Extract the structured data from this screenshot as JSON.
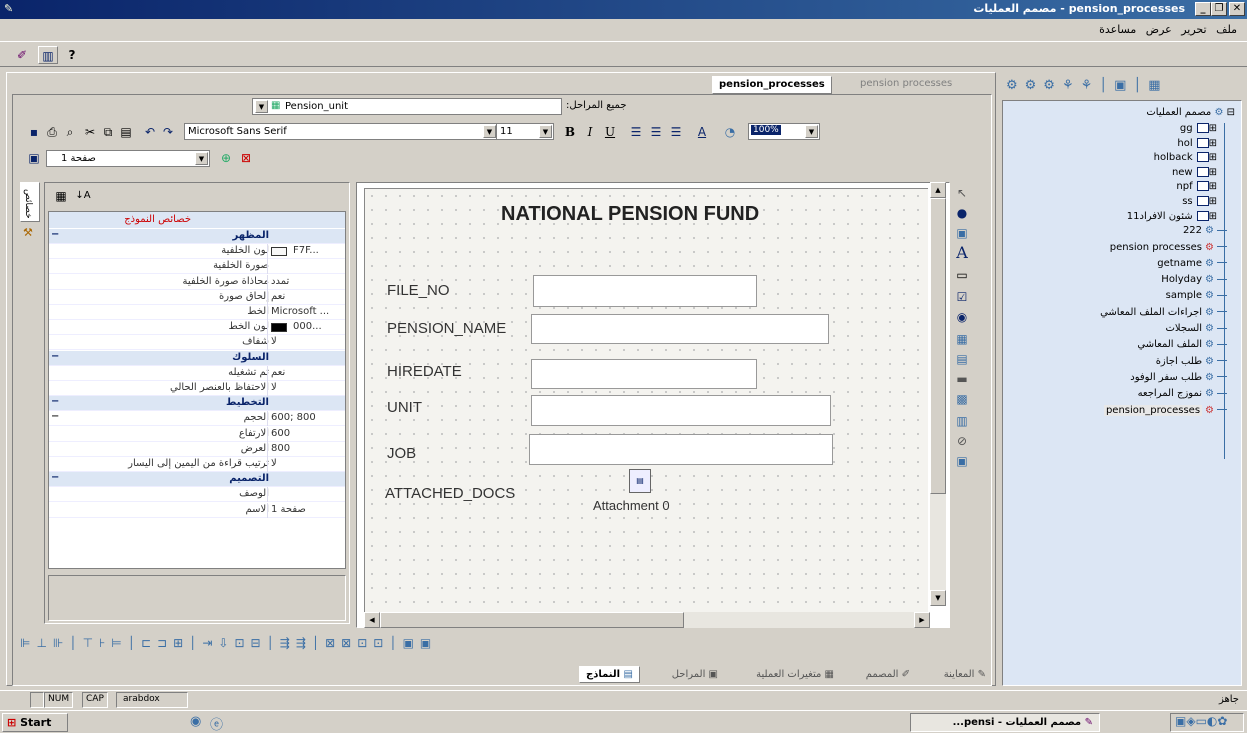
{
  "window": {
    "title": "pension_processes - مصمم العمليات"
  },
  "menu": [
    "ملف",
    "تحرير",
    "عرض",
    "مساعدة"
  ],
  "designer_tabs": {
    "active": "pension_processes",
    "inactive": "pension processes"
  },
  "stage_bar": {
    "label": "جميع المراحل:",
    "form_select": "Pension_unit"
  },
  "format_toolbar": {
    "font": "Microsoft Sans Serif",
    "size": "11",
    "zoom": "100%"
  },
  "page_select": "صفحة 1",
  "properties": {
    "side_tabs": [
      "خصائص",
      "أدوات"
    ],
    "header": "خصائص النموذج",
    "rows": [
      {
        "type": "cat",
        "label": "المظهر",
        "mark": "−"
      },
      {
        "type": "row",
        "label": "لون الخلفية",
        "value": "F7F..."
      },
      {
        "type": "row",
        "label": "صورة الخلفية",
        "value": ""
      },
      {
        "type": "row",
        "label": "محاذاة صورة الخلفية",
        "value": "تمدد"
      },
      {
        "type": "row",
        "label": "إلحاق صورة",
        "value": "نعم"
      },
      {
        "type": "row",
        "label": "الخط",
        "value": "Microsoft ..."
      },
      {
        "type": "row",
        "label": "لون الخط",
        "value": "000..."
      },
      {
        "type": "row",
        "label": "شفاف",
        "value": "لا"
      },
      {
        "type": "cat",
        "label": "السلوك",
        "mark": "−"
      },
      {
        "type": "row",
        "label": "تم تشغيله",
        "value": "نعم"
      },
      {
        "type": "row",
        "label": "الاحتفاظ بالعنصر الحالي",
        "value": "لا"
      },
      {
        "type": "cat",
        "label": "التخطيط",
        "mark": "−"
      },
      {
        "type": "row",
        "label": "الحجم",
        "value": "600; 800",
        "mark": "−"
      },
      {
        "type": "row",
        "label": "الارتفاع",
        "value": "600"
      },
      {
        "type": "row",
        "label": "العرض",
        "value": "800"
      },
      {
        "type": "row",
        "label": "ترتيب قراءة من اليمين إلى اليسار",
        "value": "لا"
      },
      {
        "type": "cat",
        "label": "التصميم",
        "mark": "−"
      },
      {
        "type": "row",
        "label": "الوصف",
        "value": ""
      },
      {
        "type": "row",
        "label": "الاسم",
        "value": "صفحة 1"
      }
    ]
  },
  "form": {
    "title": "NATIONAL PENSION FUND",
    "fields": [
      "FILE_NO",
      "PENSION_NAME",
      "HIREDATE",
      "UNIT",
      "JOB",
      "ATTACHED_DOCS"
    ],
    "attachment": "Attachment 0"
  },
  "tree": {
    "root": "مصمم العمليات",
    "folders": [
      "gg",
      "hol",
      "holback",
      "new",
      "npf",
      "ss",
      "شئون الافراد11"
    ],
    "processes": [
      "222",
      "pension processes",
      "getname",
      "Holyday",
      "sample",
      "اجراءات الملف المعاشي",
      "السجلات",
      "الملف المعاشي",
      "طلب اجازة",
      "طلب سفر الوفود",
      "نموزج المراجعه",
      "pension_processes"
    ]
  },
  "bottom_tabs": [
    "المعاينة",
    "المصمم",
    "متغيرات العملية",
    "المراحل",
    "النماذج"
  ],
  "statusbar": {
    "ready": "جاهز",
    "num": "NUM",
    "cap": "CAP",
    "user": "arabdox"
  },
  "taskbar": {
    "start": "Start",
    "task": "مصمم العمليات - pensi..."
  }
}
